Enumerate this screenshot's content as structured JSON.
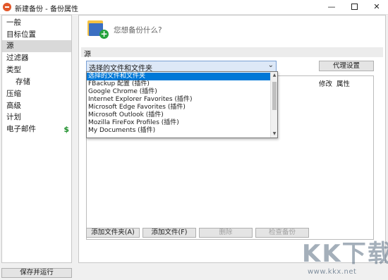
{
  "window": {
    "title": "新建备份 - 备份属性",
    "minimize": "—",
    "close": "✕"
  },
  "sidebar": {
    "items": [
      {
        "label": "一般"
      },
      {
        "label": "目标位置"
      },
      {
        "label": "源",
        "selected": true
      },
      {
        "label": "过滤器"
      },
      {
        "label": "类型"
      },
      {
        "label": "存储",
        "sub": true
      },
      {
        "label": "压缩"
      },
      {
        "label": "高级"
      },
      {
        "label": "计划"
      },
      {
        "label": "电子邮件",
        "badge": "$"
      }
    ],
    "save_run_label": "保存并运行"
  },
  "main": {
    "prompt": "您想备份什么?",
    "section_title": "源",
    "dropdown_value": "选择的文件和文件夹",
    "dropdown_options": [
      "选择的文件和文件夹",
      "FBackup 配置 (插件)",
      "Google Chrome (插件)",
      "Internet Explorer Favorites (插件)",
      "Microsoft Edge Favorites (插件)",
      "Microsoft Outlook (插件)",
      "Mozilla FireFox Profiles (插件)",
      "My Documents (插件)"
    ],
    "proxy_label": "代理设置",
    "columns": [
      "修改",
      "属性"
    ],
    "buttons": {
      "add_folder": "添加文件夹(A)",
      "add_file": "添加文件(F)",
      "delete": "删除",
      "check": "检查备份"
    }
  },
  "watermark": {
    "logo": "KK下载",
    "url": "www.kkx.net"
  },
  "colors": {
    "selection": "#0078d7",
    "accent_green": "#25a33c",
    "app_orange": "#e2572a"
  }
}
